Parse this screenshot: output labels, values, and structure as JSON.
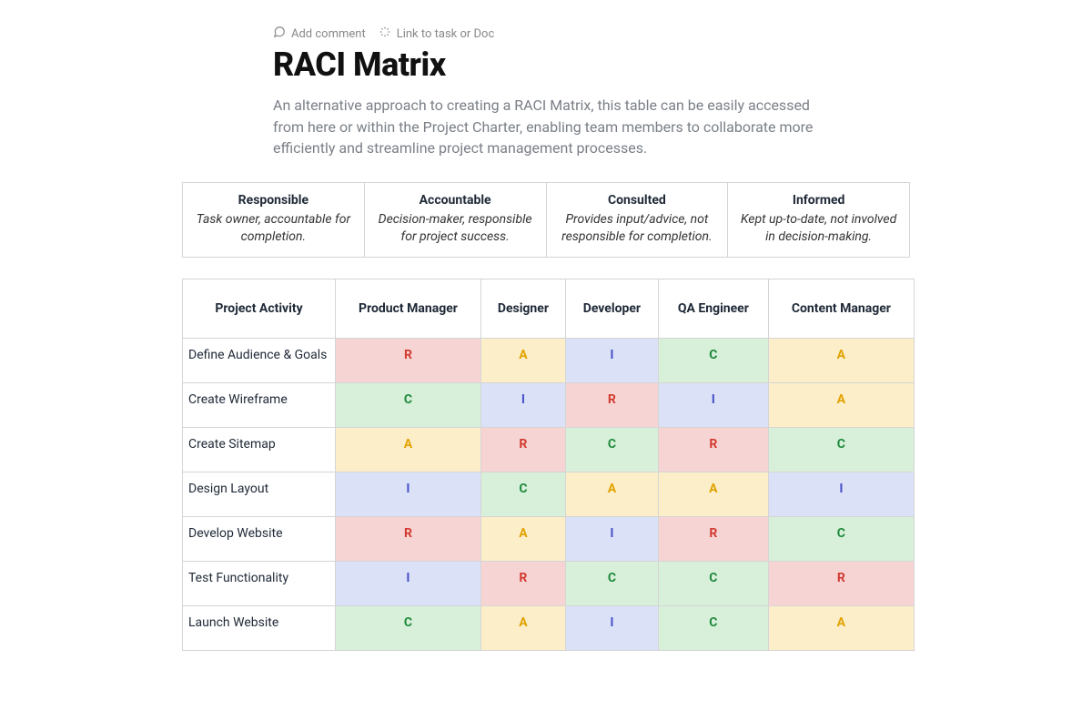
{
  "toolbar": {
    "add_comment": "Add comment",
    "link_task": "Link to task or Doc"
  },
  "title": "RACI Matrix",
  "description": "An alternative approach to creating a RACI Matrix, this table can be easily accessed from here or within the Project Charter, enabling team members to collaborate more ef­ficiently and streamline project management processes.",
  "legend": [
    {
      "title": "Responsible",
      "desc": "Task owner, accountable for completion."
    },
    {
      "title": "Accountable",
      "desc": "Decision-maker, responsible for project success."
    },
    {
      "title": "Consulted",
      "desc": "Provides input/advice, not responsible for completion."
    },
    {
      "title": "Informed",
      "desc": "Kept up-to-date, not involved in decision-making."
    }
  ],
  "matrix": {
    "headers": [
      "Project Activity",
      "Product Manager",
      "Designer",
      "Developer",
      "QA Engineer",
      "Content Manager"
    ],
    "rows": [
      {
        "activity": "Define Audience & Goals",
        "cells": [
          "R",
          "A",
          "I",
          "C",
          "A"
        ]
      },
      {
        "activity": "Create Wireframe",
        "cells": [
          "C",
          "I",
          "R",
          "I",
          "A"
        ]
      },
      {
        "activity": "Create Sitemap",
        "cells": [
          "A",
          "R",
          "C",
          "R",
          "C"
        ]
      },
      {
        "activity": "Design Layout",
        "cells": [
          "I",
          "C",
          "A",
          "A",
          "I"
        ]
      },
      {
        "activity": "Develop Website",
        "cells": [
          "R",
          "A",
          "I",
          "R",
          "C"
        ]
      },
      {
        "activity": "Test Functionality",
        "cells": [
          "I",
          "R",
          "C",
          "C",
          "R"
        ]
      },
      {
        "activity": "Launch Website",
        "cells": [
          "C",
          "A",
          "I",
          "C",
          "A"
        ]
      }
    ]
  }
}
